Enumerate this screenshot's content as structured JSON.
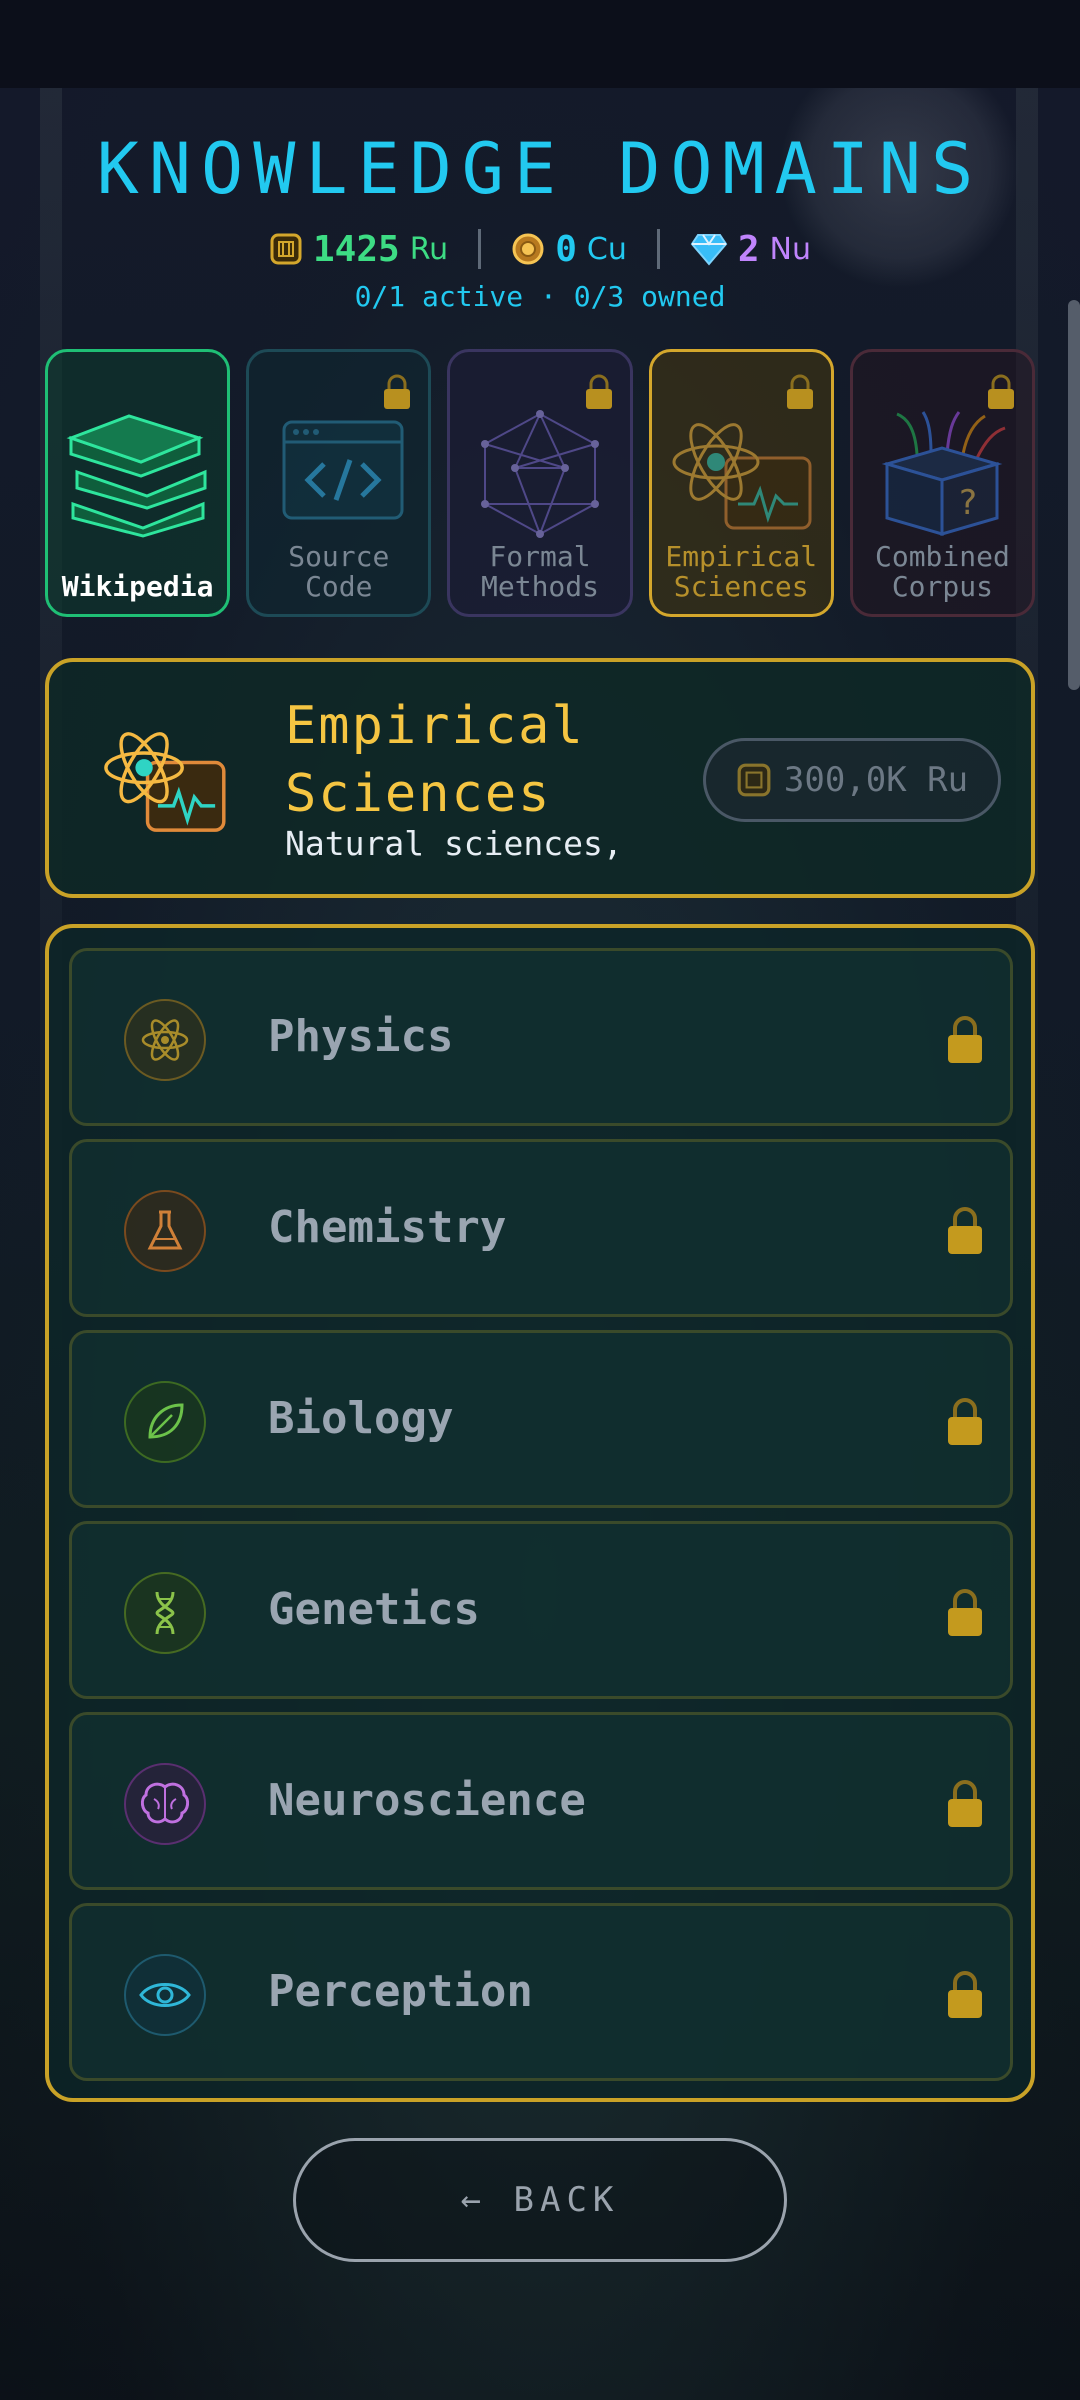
{
  "header": {
    "title": "KNOWLEDGE DOMAINS",
    "currencies": [
      {
        "amount": "1425",
        "unit": "Ru",
        "icon": "chip-coin-icon",
        "color": "#3ddc84"
      },
      {
        "amount": "0",
        "unit": "Cu",
        "icon": "gold-coin-icon",
        "color": "#22c9f0"
      },
      {
        "amount": "2",
        "unit": "Nu",
        "icon": "diamond-icon",
        "color": "#c084fc"
      }
    ],
    "status": "0/1 active · 0/3 owned"
  },
  "domains": [
    {
      "label": "Wikipedia",
      "icon": "books-icon",
      "state": "active"
    },
    {
      "label": "Source Code",
      "icon": "code-window-icon",
      "state": "locked"
    },
    {
      "label": "Formal Methods",
      "icon": "graph-network-icon",
      "state": "locked"
    },
    {
      "label": "Empirical Sciences",
      "icon": "atom-folder-icon",
      "state": "selected-locked"
    },
    {
      "label": "Combined Corpus",
      "icon": "mystery-box-icon",
      "state": "locked"
    }
  ],
  "selected_domain": {
    "title_line1": "Empirical",
    "title_line2": "Sciences",
    "subtitle": "Natural sciences,",
    "price": "300,0K Ru",
    "accent": "#f5c542"
  },
  "subdomains": [
    {
      "label": "Physics",
      "icon": "atom-icon",
      "color": "#c9a227"
    },
    {
      "label": "Chemistry",
      "icon": "flask-icon",
      "color": "#e08a3a"
    },
    {
      "label": "Biology",
      "icon": "leaf-icon",
      "color": "#6cc24a"
    },
    {
      "label": "Genetics",
      "icon": "dna-icon",
      "color": "#8bc34a"
    },
    {
      "label": "Neuroscience",
      "icon": "brain-icon",
      "color": "#c070e0"
    },
    {
      "label": "Perception",
      "icon": "eye-icon",
      "color": "#2fb7d8"
    }
  ],
  "back_label": "← BACK"
}
